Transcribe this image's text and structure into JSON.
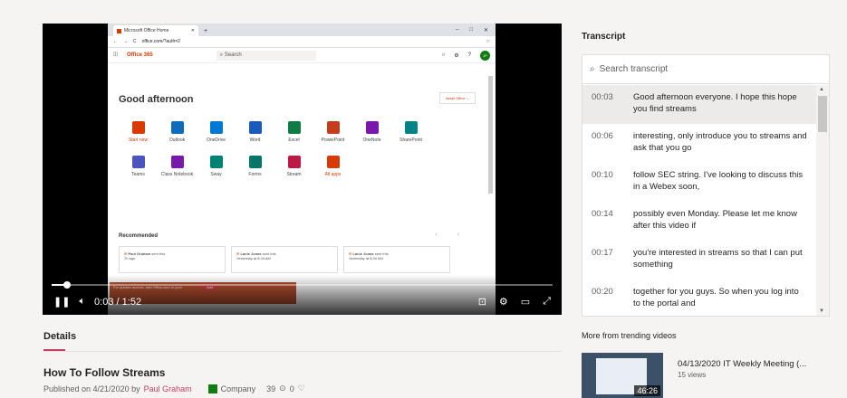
{
  "video": {
    "browser": {
      "tab_title": "Microsoft Office Home",
      "url": "office.com/?auth=2",
      "brand": "Office 365",
      "search_placeholder": "Search",
      "avatar": "JP",
      "greeting": "Good afternoon",
      "install": "Install Office",
      "apps": [
        {
          "label": "Start new",
          "color": "#d83b01",
          "red": true
        },
        {
          "label": "Outlook",
          "color": "#0f6cbd"
        },
        {
          "label": "OneDrive",
          "color": "#0078d4"
        },
        {
          "label": "Word",
          "color": "#185abd"
        },
        {
          "label": "Excel",
          "color": "#107c41"
        },
        {
          "label": "PowerPoint",
          "color": "#c43e1c"
        },
        {
          "label": "OneNote",
          "color": "#7719aa"
        },
        {
          "label": "SharePoint",
          "color": "#038387"
        },
        {
          "label": "",
          "color": "transparent"
        },
        {
          "label": "Teams",
          "color": "#4b53bc"
        },
        {
          "label": "Class Notebook",
          "color": "#7719aa"
        },
        {
          "label": "Sway",
          "color": "#008272"
        },
        {
          "label": "Forms",
          "color": "#077568"
        },
        {
          "label": "Stream",
          "color": "#bc1948"
        },
        {
          "label": "All apps",
          "color": "#d83b01",
          "red": true
        }
      ],
      "recommended": "Recommended",
      "cards": [
        {
          "who": "Paul Graham",
          "text": "sent this",
          "when": "7h ago"
        },
        {
          "who": "Lanie Jonas",
          "text": "sent this",
          "when": "Yesterday at 8:34 AM"
        },
        {
          "who": "Lanie Jonas",
          "text": "sent this",
          "when": "Yesterday at 8:34 AM"
        }
      ],
      "banner": "For quicker access, add Office.com to your",
      "banner_btn": "Add"
    },
    "controls": {
      "current": "0:03",
      "sep": "/",
      "duration": "1:52",
      "progress": 0.03
    }
  },
  "details": {
    "tab": "Details",
    "title": "How To Follow Streams",
    "published": "Published on 4/21/2020 by",
    "author": "Paul Graham",
    "group": "Company",
    "views": "39",
    "likes": "0"
  },
  "transcript": {
    "title": "Transcript",
    "search_placeholder": "Search transcript",
    "rows": [
      {
        "ts": "00:03",
        "text": "Good afternoon everyone. I hope this hope you find streams",
        "active": true
      },
      {
        "ts": "00:06",
        "text": "interesting, only introduce you to streams and ask that you go"
      },
      {
        "ts": "00:10",
        "text": "follow SEC string. I've looking to discuss this in a Webex soon,"
      },
      {
        "ts": "00:14",
        "text": "possibly even Monday. Please let me know after this video if"
      },
      {
        "ts": "00:17",
        "text": "you're interested in streams so that I can put something"
      },
      {
        "ts": "00:20",
        "text": "together for you guys. So when you log into to the portal and"
      }
    ]
  },
  "trending": {
    "heading": "More from trending videos",
    "video": {
      "title": "04/13/2020 IT Weekly Meeting (...",
      "views": "15 views",
      "duration": "46:26"
    }
  }
}
